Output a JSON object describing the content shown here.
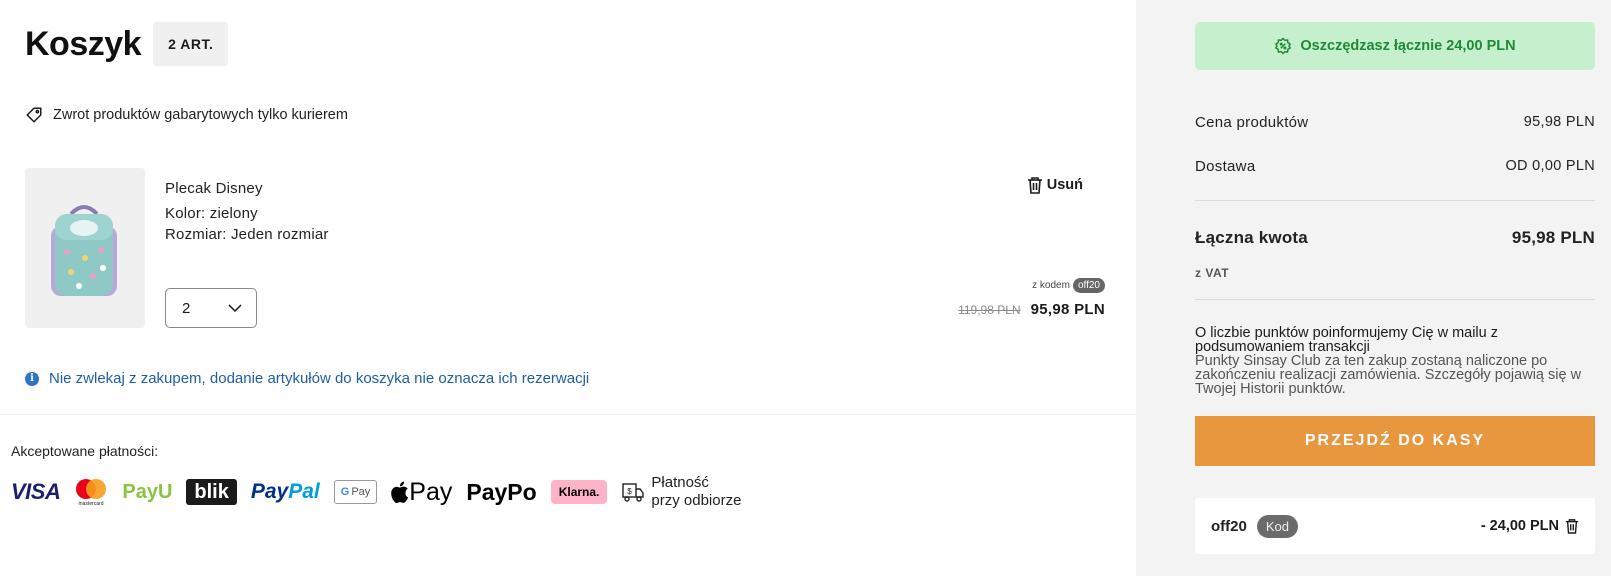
{
  "cart": {
    "title": "Koszyk",
    "item_count": "2 ART.",
    "return_notice": "Zwrot produktów gabarytowych tylko kurierem",
    "items": [
      {
        "name": "Plecak Disney",
        "color": "Kolor: zielony",
        "size": "Rozmiar: Jeden rozmiar",
        "quantity": "2",
        "remove_label": "Usuń",
        "code_prefix": "z kodem",
        "code": "off20",
        "old_price": "119,98 PLN",
        "new_price": "95,98 PLN"
      }
    ],
    "reservation_info": "Nie zwlekaj z zakupem, dodanie artykułów do koszyka nie oznacza ich rezerwacji"
  },
  "payments": {
    "title": "Akceptowane płatności:",
    "logos": {
      "visa": "VISA",
      "mastercard_caption": "mastercard",
      "payu": "PayU",
      "blik": "blik",
      "paypal_a": "Pay",
      "paypal_b": "Pal",
      "gpay_g": "G",
      "gpay_text": "Pay",
      "apple_pay": "Pay",
      "paypo": "PayPo",
      "klarna": "Klarna."
    },
    "cod_line1": "Płatność",
    "cod_line2": "przy odbiorze"
  },
  "summary": {
    "savings": "Oszczędzasz łącznie 24,00 PLN",
    "products_label": "Cena produktów",
    "products_value": "95,98 PLN",
    "delivery_label": "Dostawa",
    "delivery_value": "OD 0,00 PLN",
    "total_label": "Łączna kwota",
    "total_value": "95,98 PLN",
    "vat_note": "z VAT",
    "points_bold": "O liczbie punktów poinformujemy Cię w mailu z podsumowaniem transakcji",
    "points_text": "Punkty Sinsay Club za ten zakup zostaną naliczone po zakończeniu realizacji zamówienia. Szczegóły pojawią się w Twojej Historii punktów.",
    "checkout_label": "PRZEJDŹ DO KASY",
    "coupon_code": "off20",
    "coupon_tag": "Kod",
    "coupon_discount": "- 24,00 PLN"
  },
  "colors": {
    "accent_checkout": "#e8973f",
    "savings_bg": "#c6efcd",
    "savings_text": "#1e8a36",
    "info_blue": "#1f5fa8"
  }
}
